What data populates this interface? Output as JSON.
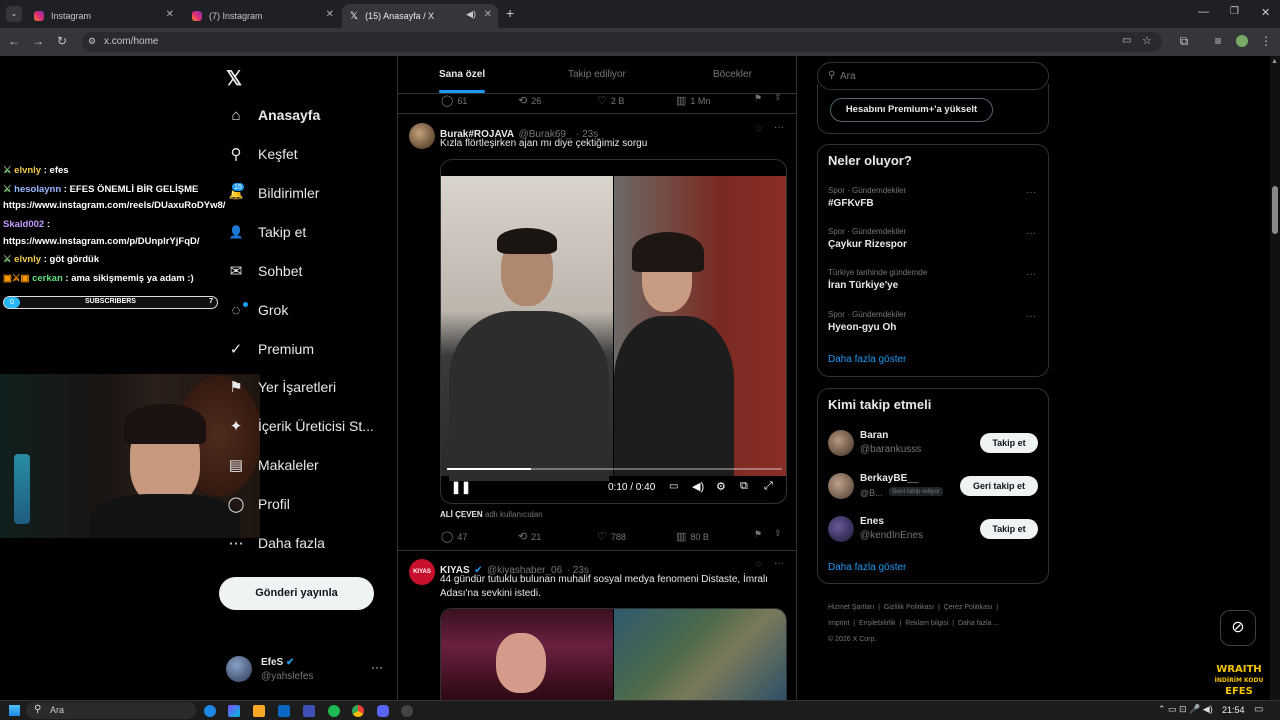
{
  "browser": {
    "tabs": [
      {
        "title": "Instagram",
        "color": "#d6249f"
      },
      {
        "title": "(7) Instagram",
        "color": "#d6249f"
      },
      {
        "title": "(15) Anasayfa / X",
        "color": "#e7e9ea"
      }
    ],
    "url": "x.com/home"
  },
  "stream_overlay": {
    "chat": [
      {
        "user": "elvnly",
        "text": " : efes",
        "color": "#f2c94c"
      },
      {
        "user": "hesolaynn",
        "text": " : EFES ÖNEMLİ BİR GELİŞME",
        "color": "#9bb6ff"
      },
      {
        "text": "https://www.instagram.com/reels/DUaxuRoDYw8/"
      },
      {
        "user": "Skald002",
        "text": " :",
        "color": "#c39bff"
      },
      {
        "text": "https://www.instagram.com/p/DUnplrYjFqD/"
      },
      {
        "user": "elvnly",
        "text": " : göt gördük",
        "color": "#f2c94c"
      },
      {
        "user": "cerkan",
        "text": " : ama sikişmemiş ya adam :)",
        "color": "#5ee07b"
      }
    ],
    "subscribers": {
      "label": "SUBSCRIBERS",
      "current": "0",
      "goal": "7"
    },
    "promo": {
      "line1": "WRAITH",
      "line2": "İNDİRİM KODU",
      "line3": "EFES"
    }
  },
  "sidebar": {
    "notif_badge": "15",
    "items": [
      {
        "label": "Anasayfa",
        "icon": "home-icon",
        "glyph": "⌂"
      },
      {
        "label": "Keşfet",
        "icon": "search-icon",
        "glyph": "⚲"
      },
      {
        "label": "Bildirimler",
        "icon": "bell-icon",
        "glyph": "🔔"
      },
      {
        "label": "Takip et",
        "icon": "follow-icon",
        "glyph": "👤"
      },
      {
        "label": "Sohbet",
        "icon": "mail-icon",
        "glyph": "✉"
      },
      {
        "label": "Grok",
        "icon": "grok-icon",
        "glyph": "◌"
      },
      {
        "label": "Premium",
        "icon": "premium-icon",
        "glyph": "✓"
      },
      {
        "label": "Yer İşaretleri",
        "icon": "bookmark-icon",
        "glyph": "⚑"
      },
      {
        "label": "İçerik Üreticisi St...",
        "icon": "creator-icon",
        "glyph": "✦"
      },
      {
        "label": "Makaleler",
        "icon": "articles-icon",
        "glyph": "▤"
      },
      {
        "label": "Profil",
        "icon": "profile-icon",
        "glyph": "◯"
      },
      {
        "label": "Daha fazla",
        "icon": "more-icon",
        "glyph": "⋯"
      }
    ],
    "post_button": "Gönderi yayınla",
    "account": {
      "name": "EfeS",
      "handle": "@yahslefes"
    }
  },
  "timeline": {
    "tabs": [
      "Sana özel",
      "Takip ediliyor",
      "Böcekler"
    ],
    "prev_actions": {
      "replies": "61",
      "reposts": "26",
      "likes": "2 B",
      "views": "1 Mn"
    },
    "tweet1": {
      "name": "Burak#ROJAVA",
      "handle": "@Burak69_",
      "time": "· 23s",
      "text": "Kızla flörtleşirken ajan mı diye çektiğimiz sorgu",
      "video_time": "0:10 / 0:40",
      "video_progress": 0.25,
      "attribution_name": "ALİ ÇEVEN",
      "attribution_rest": "adlı kullanıcıdan",
      "replies": "47",
      "reposts": "21",
      "likes": "788",
      "views": "80 B"
    },
    "tweet2": {
      "name": "KIYAS",
      "handle": "@kiyashaber_06",
      "time": "· 23s",
      "avatar_text": "KIYAS",
      "text": "44 gündür tutuklu bulunan muhalif sosyal medya fenomeni Distaste, İmralı Adası'na sevkini istedi."
    }
  },
  "right": {
    "search_placeholder": "Ara",
    "premium_button": "Hesabını Premium+'a yükselt",
    "trends_title": "Neler oluyor?",
    "trends": [
      {
        "category": "Spor · Gündemdekiler",
        "name": "#GFKvFB"
      },
      {
        "category": "Spor · Gündemdekiler",
        "name": "Çaykur Rizespor"
      },
      {
        "category": "Türkiye tarihinde gündemde",
        "name": "İran Türkiye'ye"
      },
      {
        "category": "Spor · Gündemdekiler",
        "name": "Hyeon-gyu Oh"
      }
    ],
    "show_more": "Daha fazla göster",
    "who_title": "Kimi takip etmeli",
    "who": [
      {
        "name": "Baran",
        "handle": "@barankusss",
        "button": "Takip et"
      },
      {
        "name": "BerkayBE__",
        "handle": "@B...",
        "badge": "Seni takip ediyor",
        "button": "Geri takip et"
      },
      {
        "name": "Enes",
        "handle": "@kendInEnes",
        "button": "Takip et"
      }
    ],
    "who_more": "Daha fazla göster",
    "footer": {
      "l1": [
        "Hizmet Şartları",
        "Gizlilik Politikası",
        "Çerez Politikası"
      ],
      "l2": [
        "Imprint",
        "Erişilebilirlik",
        "Reklam bilgisi",
        "Daha fazla ..."
      ],
      "copy": "© 2026 X Corp."
    }
  },
  "taskbar": {
    "search": "Ara",
    "time": "21:54"
  }
}
